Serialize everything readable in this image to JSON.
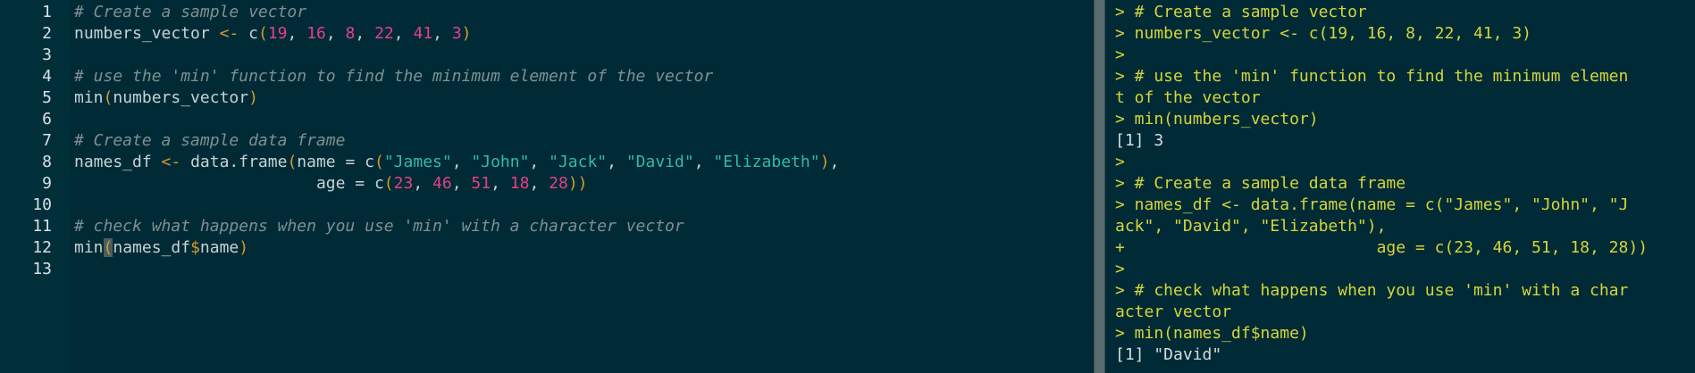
{
  "editor": {
    "line_numbers": [
      "1",
      "2",
      "3",
      "4",
      "5",
      "6",
      "7",
      "8",
      "9",
      "10",
      "11",
      "12",
      "13"
    ],
    "lines": {
      "l1": {
        "comment": "# Create a sample vector"
      },
      "l2": {
        "ident": "numbers_vector ",
        "assign": "<-",
        "fn": " c",
        "open": "(",
        "nums": [
          "19",
          "16",
          "8",
          "22",
          "41",
          "3"
        ],
        "sep": ", ",
        "close": ")"
      },
      "l4": {
        "comment": "# use the 'min' function to find the minimum element of the vector"
      },
      "l5": {
        "fn": "min",
        "open": "(",
        "arg": "numbers_vector",
        "close": ")"
      },
      "l7": {
        "comment": "# Create a sample data frame"
      },
      "l8": {
        "ident": "names_df ",
        "assign": "<-",
        "fn": " data.frame",
        "open": "(",
        "param": "name = c",
        "inner_open": "(",
        "strs": [
          "\"James\"",
          "\"John\"",
          "\"Jack\"",
          "\"David\"",
          "\"Elizabeth\""
        ],
        "sep": ", ",
        "inner_close": ")",
        "trail": ","
      },
      "l9": {
        "indent": "                         ",
        "param": "age = c",
        "inner_open": "(",
        "nums": [
          "23",
          "46",
          "51",
          "18",
          "28"
        ],
        "sep": ", ",
        "inner_close": ")",
        "close": ")"
      },
      "l11": {
        "comment": "# check what happens when you use 'min' with a character vector"
      },
      "l12": {
        "fn": "min",
        "open": "(",
        "arg1": "names_df",
        "dollar": "$",
        "arg2": "name",
        "close": ")"
      }
    }
  },
  "console": {
    "lines": [
      "> # Create a sample vector",
      "> numbers_vector <- c(19, 16, 8, 22, 41, 3)",
      ">",
      "> # use the 'min' function to find the minimum elemen",
      "t of the vector",
      "> min(numbers_vector)",
      "[1] 3",
      ">",
      "> # Create a sample data frame",
      "> names_df <- data.frame(name = c(\"James\", \"John\", \"J",
      "ack\", \"David\", \"Elizabeth\"),",
      "+                          age = c(23, 46, 51, 18, 28))",
      ">",
      "> # check what happens when you use 'min' with a char",
      "acter vector",
      "> min(names_df$name)",
      "[1] \"David\""
    ]
  },
  "colors": {
    "background": "#002b36",
    "gutter": "#002f3a",
    "comment": "#7f8f92",
    "operator": "#d59a2c",
    "number": "#e0408d",
    "string": "#35b9a8",
    "console_input": "#d5d43b",
    "console_output": "#d6dde0"
  }
}
